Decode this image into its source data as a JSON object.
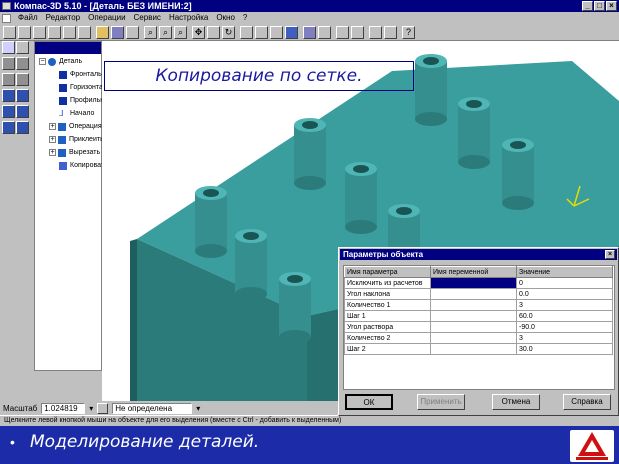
{
  "window": {
    "title": "Компас-3D 5.10 - [Деталь БЕЗ ИМЕНИ:2]"
  },
  "menu": [
    "Файл",
    "Редактор",
    "Операции",
    "Сервис",
    "Настройка",
    "Окно",
    "?"
  ],
  "tree": {
    "items": [
      {
        "label": "Деталь"
      },
      {
        "label": "Фронтальная"
      },
      {
        "label": "Горизонтальная"
      },
      {
        "label": "Профильная"
      },
      {
        "label": "Начало"
      },
      {
        "label": "Операция"
      },
      {
        "label": "Приклеить"
      },
      {
        "label": "Вырезать"
      },
      {
        "label": "Копировать"
      }
    ]
  },
  "viewport": {
    "caption": "Копирование по сетке."
  },
  "dialog": {
    "title": "Параметры объекта",
    "columns": [
      "Имя параметра",
      "Имя переменной",
      "Значение"
    ],
    "rows": [
      {
        "name": "Исключить из расчетов",
        "var": "",
        "value": "0"
      },
      {
        "name": "Угол наклона",
        "var": "",
        "value": "0.0"
      },
      {
        "name": "Количество 1",
        "var": "",
        "value": "3"
      },
      {
        "name": "Шаг 1",
        "var": "",
        "value": "60.0"
      },
      {
        "name": "Угол раствора",
        "var": "",
        "value": "-90.0"
      },
      {
        "name": "Количество 2",
        "var": "",
        "value": "3"
      },
      {
        "name": "Шаг 2",
        "var": "",
        "value": "30.0"
      }
    ],
    "buttons": {
      "ok": "ОК",
      "apply": "Применить",
      "cancel": "Отмена",
      "help": "Справка"
    }
  },
  "scale": {
    "label": "Масштаб",
    "value": "1.024819",
    "mode": "Не определена"
  },
  "status": "Щелкните левой кнопкой мыши на объекте для его выделения (вместе с Ctrl - добавить к выделенным)",
  "footer": {
    "bullet": "•",
    "text": "Моделирование деталей."
  },
  "colors": {
    "model": "#3a9e9e",
    "title": "#000080",
    "footer": "#1c2ca8"
  }
}
